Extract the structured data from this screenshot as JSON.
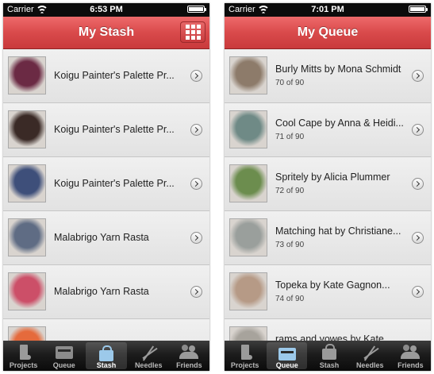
{
  "status_left": {
    "carrier": "Carrier",
    "time": "6:53 PM",
    "battery_level": 1.0
  },
  "status_right": {
    "carrier": "Carrier",
    "time": "7:01 PM",
    "battery_level": 1.0
  },
  "left_screen": {
    "title": "My Stash",
    "items": [
      {
        "title": "Koigu Painter's Palette Pr...",
        "thumb_color": "#6b2a44"
      },
      {
        "title": "Koigu Painter's Palette Pr...",
        "thumb_color": "#3a2a26"
      },
      {
        "title": "Koigu Painter's Palette Pr...",
        "thumb_color": "#3e4f7a"
      },
      {
        "title": "Malabrigo Yarn Rasta",
        "thumb_color": "#5f6c84"
      },
      {
        "title": "Malabrigo Yarn Rasta",
        "thumb_color": "#cc4f68"
      },
      {
        "title": "",
        "thumb_color": "#e56a3c"
      }
    ]
  },
  "right_screen": {
    "title": "My Queue",
    "items": [
      {
        "title": "Burly Mitts by Mona Schmidt",
        "subtitle": "70 of 90",
        "thumb_color": "#8d7b6a"
      },
      {
        "title": "Cool Cape by Anna & Heidi...",
        "subtitle": "71 of 90",
        "thumb_color": "#6f8a86"
      },
      {
        "title": "Spritely by Alicia Plummer",
        "subtitle": "72 of 90",
        "thumb_color": "#6c8d4e"
      },
      {
        "title": "Matching hat by Christiane...",
        "subtitle": "73 of 90",
        "thumb_color": "#9a9f9c"
      },
      {
        "title": "Topeka by Kate Gagnon...",
        "subtitle": "74 of 90",
        "thumb_color": "#b69a86"
      },
      {
        "title": "rams and yowes by Kate...",
        "subtitle": "",
        "thumb_color": "#a7a39c"
      }
    ]
  },
  "tabs_left": {
    "active": "Stash",
    "items": [
      {
        "label": "Projects",
        "icon": "boot-icon"
      },
      {
        "label": "Queue",
        "icon": "queue-icon"
      },
      {
        "label": "Stash",
        "icon": "bag-icon"
      },
      {
        "label": "Needles",
        "icon": "needles-icon"
      },
      {
        "label": "Friends",
        "icon": "friends-icon"
      }
    ]
  },
  "tabs_right": {
    "active": "Queue",
    "items": [
      {
        "label": "Projects",
        "icon": "boot-icon"
      },
      {
        "label": "Queue",
        "icon": "queue-icon"
      },
      {
        "label": "Stash",
        "icon": "bag-icon"
      },
      {
        "label": "Needles",
        "icon": "needles-icon"
      },
      {
        "label": "Friends",
        "icon": "friends-icon"
      }
    ]
  }
}
